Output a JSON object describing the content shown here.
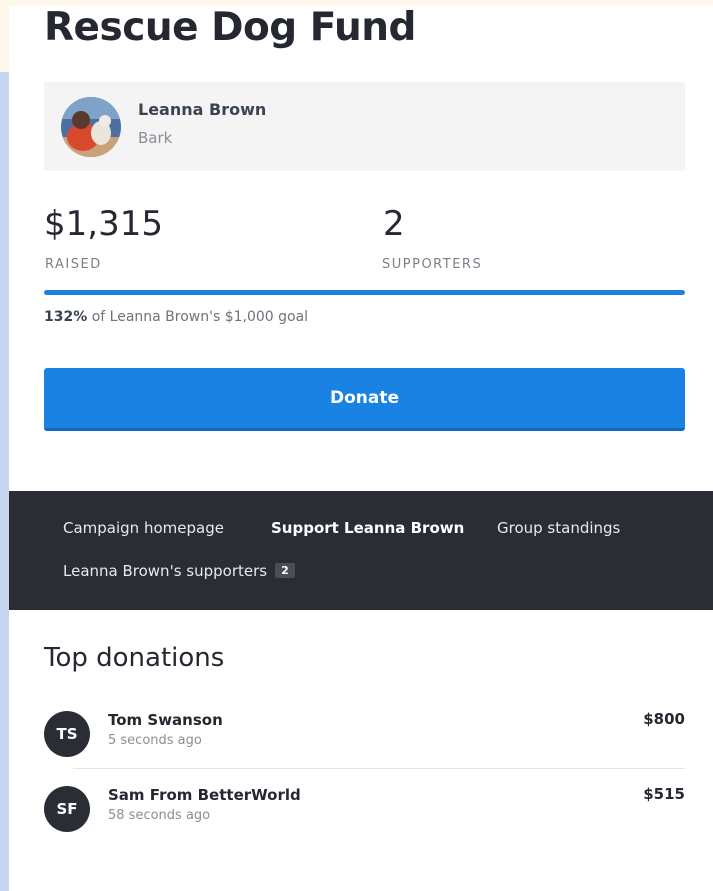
{
  "campaign": {
    "title": "Rescue Dog Fund"
  },
  "owner": {
    "name": "Leanna Brown",
    "team": "Bark"
  },
  "stats": {
    "raised_value": "$1,315",
    "raised_label": "RAISED",
    "supporters_value": "2",
    "supporters_label": "SUPPORTERS"
  },
  "progress": {
    "percent_text": "132%",
    "goal_suffix": " of Leanna Brown's $1,000 goal",
    "fraction": 1.32
  },
  "donate": {
    "label": "Donate"
  },
  "nav": {
    "items": [
      {
        "label": "Campaign homepage"
      },
      {
        "label": "Support Leanna Brown"
      },
      {
        "label": "Group standings"
      },
      {
        "label": "Leanna Brown's supporters"
      }
    ],
    "supporters_badge": "2",
    "active": "Support Leanna Brown"
  },
  "top_donations": {
    "title": "Top donations",
    "rows": [
      {
        "initials": "TS",
        "name": "Tom Swanson",
        "time": "5 seconds ago",
        "amount": "$800"
      },
      {
        "initials": "SF",
        "name": "Sam From BetterWorld",
        "time": "58 seconds ago",
        "amount": "$515"
      }
    ]
  },
  "colors": {
    "accent": "#1a82e2",
    "nav_background": "#2a2d34",
    "page_background": "#fdf7ec"
  }
}
